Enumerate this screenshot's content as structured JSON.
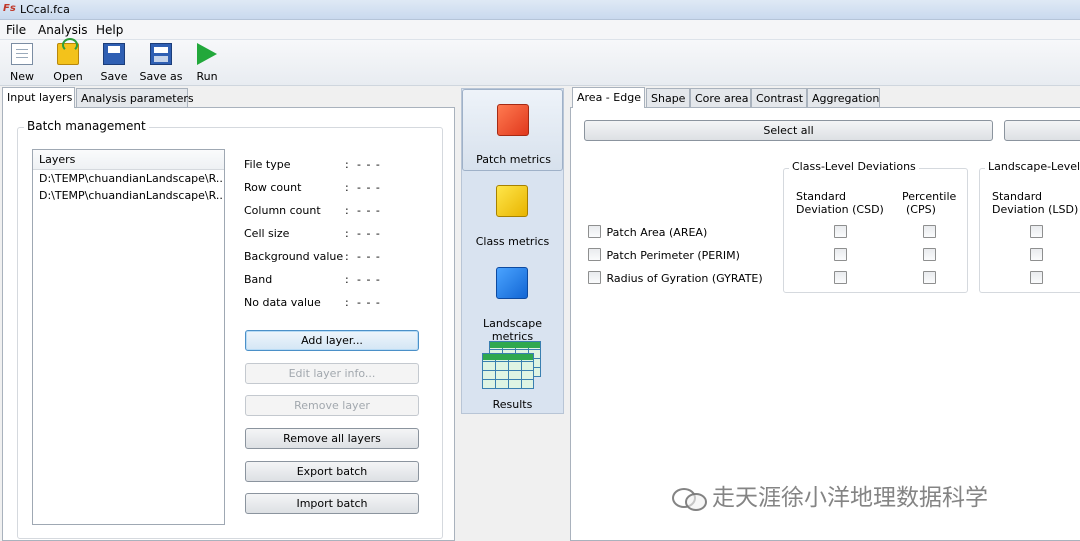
{
  "window": {
    "title": "LCcal.fca"
  },
  "menu": [
    "File",
    "Analysis",
    "Help"
  ],
  "toolbar": {
    "new": "New",
    "open": "Open",
    "save": "Save",
    "save_as": "Save as",
    "run": "Run"
  },
  "left_tabs": [
    "Input layers",
    "Analysis parameters"
  ],
  "batch": {
    "legend": "Batch management",
    "layers_header": "Layers",
    "layers": [
      "D:\\TEMP\\chuandianLandscape\\R...",
      "D:\\TEMP\\chuandianLandscape\\R..."
    ],
    "info": [
      {
        "label": "File type",
        "value": "- - -"
      },
      {
        "label": "Row count",
        "value": "- - -"
      },
      {
        "label": "Column count",
        "value": "- - -"
      },
      {
        "label": "Cell size",
        "value": "- - -"
      },
      {
        "label": "Background value",
        "value": "- - -"
      },
      {
        "label": "Band",
        "value": "- - -"
      },
      {
        "label": "No data value",
        "value": "- - -"
      }
    ],
    "separator": ":",
    "buttons": {
      "add_layer": "Add layer...",
      "edit_layer_info": "Edit layer info...",
      "remove_layer": "Remove layer",
      "remove_all_layers": "Remove all layers",
      "export_batch": "Export batch",
      "import_batch": "Import batch"
    }
  },
  "nav": {
    "patch_metrics": "Patch metrics",
    "class_metrics": "Class metrics",
    "landscape_metrics": "Landscape metrics",
    "results": "Results"
  },
  "right_tabs": [
    "Area - Edge",
    "Shape",
    "Core area",
    "Contrast",
    "Aggregation"
  ],
  "area_edge": {
    "select_all": "Select all",
    "class_group": "Class-Level Deviations",
    "landscape_group": "Landscape-Level D",
    "col_csd": [
      "Standard",
      "Deviation  (CSD)"
    ],
    "col_cps": [
      "Percentile",
      "(CPS)"
    ],
    "col_lsd": [
      "Standard",
      "Deviation  (LSD)"
    ],
    "metrics": [
      "Patch Area  (AREA)",
      "Patch Perimeter  (PERIM)",
      "Radius of Gyration  (GYRATE)"
    ]
  },
  "watermark": "走天涯徐小洋地理数据科学"
}
